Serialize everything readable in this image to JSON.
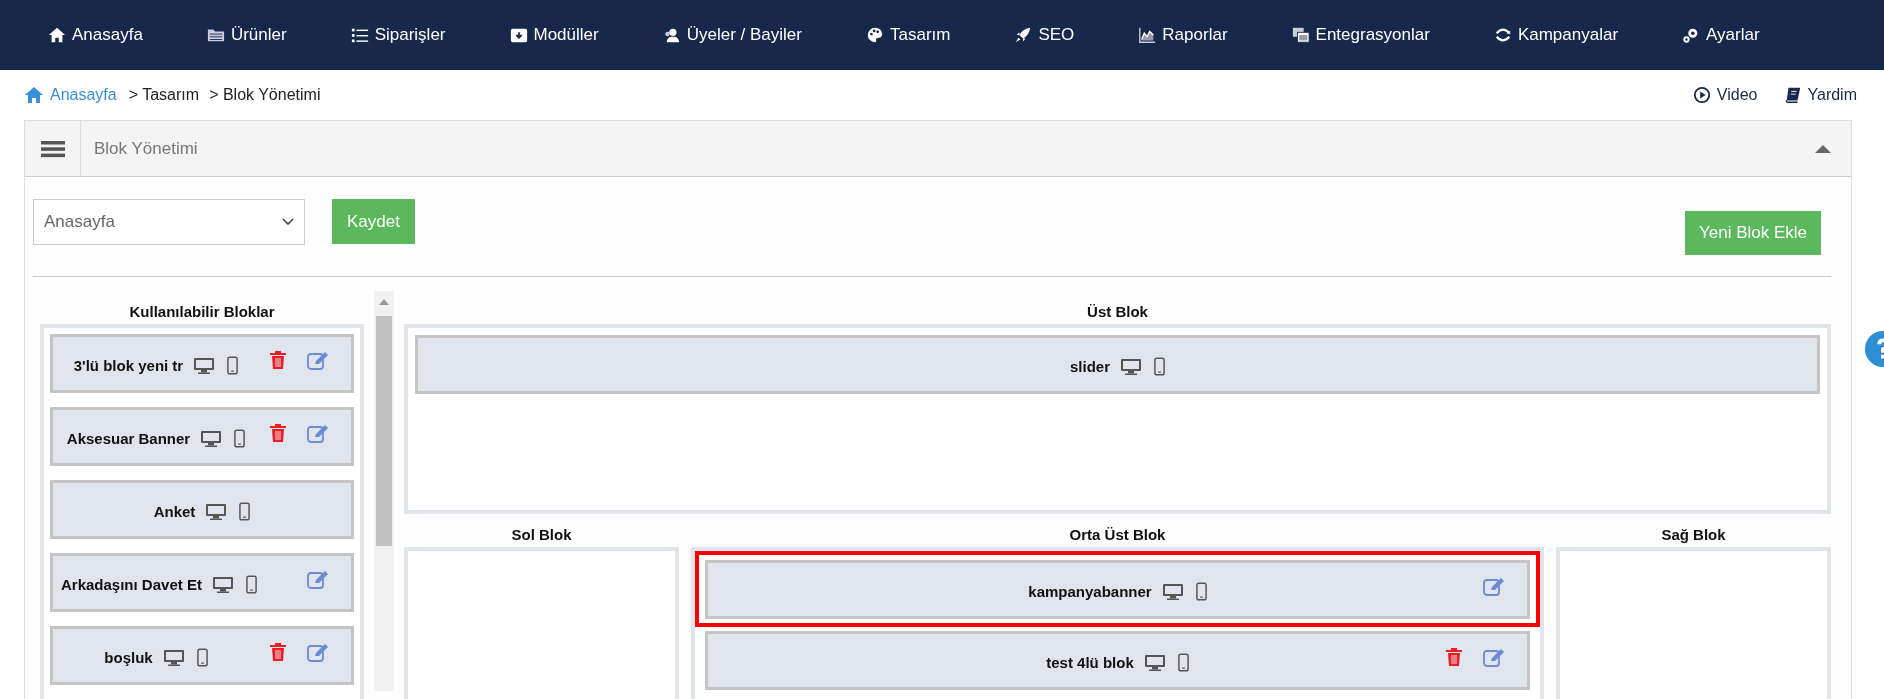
{
  "nav": [
    {
      "label": "Anasayfa"
    },
    {
      "label": "Ürünler"
    },
    {
      "label": "Siparişler"
    },
    {
      "label": "Modüller"
    },
    {
      "label": "Üyeler / Bayiler"
    },
    {
      "label": "Tasarım"
    },
    {
      "label": "SEO"
    },
    {
      "label": "Raporlar"
    },
    {
      "label": "Entegrasyonlar"
    },
    {
      "label": "Kampanyalar"
    },
    {
      "label": "Ayarlar"
    }
  ],
  "breadcrumb": {
    "home": "Anasayfa",
    "items": [
      "> Tasarım",
      "> Blok Yönetimi"
    ]
  },
  "help_links": [
    {
      "label": "Video"
    },
    {
      "label": "Yardim"
    }
  ],
  "panel": {
    "title": "Blok Yönetimi",
    "page_select": {
      "value": "Anasayfa"
    },
    "save_button": "Kaydet",
    "add_button": "Yeni Blok Ekle",
    "available": {
      "title": "Kullanılabilir Bloklar",
      "blocks": [
        {
          "name": "3'lü blok yeni tr",
          "deletable": true,
          "editable": true
        },
        {
          "name": "Aksesuar Banner",
          "deletable": true,
          "editable": true
        },
        {
          "name": "Anket",
          "deletable": false,
          "editable": false
        },
        {
          "name": "Arkadaşını Davet Et",
          "deletable": false,
          "editable": true
        },
        {
          "name": "boşluk",
          "deletable": true,
          "editable": true
        }
      ]
    },
    "top": {
      "title": "Üst Blok",
      "blocks": [
        {
          "name": "slider",
          "deletable": false,
          "editable": false,
          "highlighted": false
        }
      ]
    },
    "left": {
      "title": "Sol Blok"
    },
    "middle": {
      "title": "Orta Üst Blok",
      "blocks": [
        {
          "name": "kampanyabanner",
          "deletable": false,
          "editable": true,
          "highlighted": true
        },
        {
          "name": "test 4lü blok",
          "deletable": true,
          "editable": true,
          "highlighted": false
        }
      ]
    },
    "right": {
      "title": "Sağ Blok"
    }
  }
}
